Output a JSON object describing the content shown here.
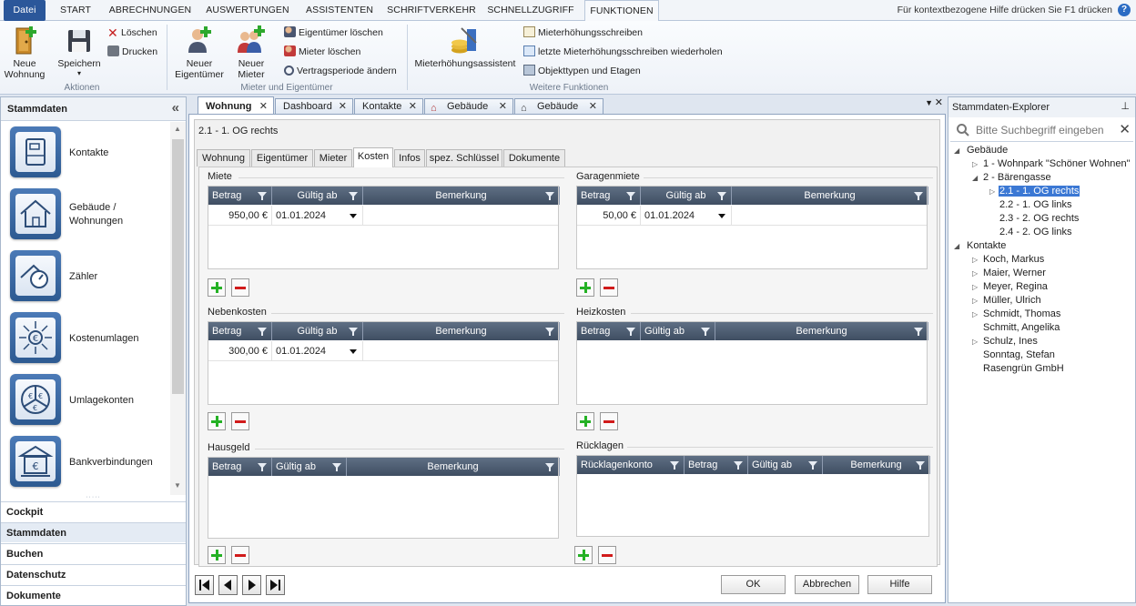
{
  "menu": {
    "tabs": [
      "Datei",
      "START",
      "ABRECHNUNGEN",
      "AUSWERTUNGEN",
      "ASSISTENTEN",
      "SCHRIFTVERKEHR",
      "SCHNELLZUGRIFF",
      "FUNKTIONEN"
    ],
    "help_text": "Für kontextbezogene Hilfe drücken Sie F1 drücken",
    "help_icon": "?"
  },
  "ribbon": {
    "neue_wohnung": "Neue Wohnung",
    "speichern": "Speichern",
    "loeschen": "Löschen",
    "drucken": "Drucken",
    "group_aktionen": "Aktionen",
    "neuer_eigentuemer": "Neuer Eigentümer",
    "neuer_mieter": "Neuer Mieter",
    "eigentuemer_loeschen": "Eigentümer löschen",
    "mieter_loeschen": "Mieter löschen",
    "vertragsperiode": "Vertragsperiode ändern",
    "group_mieter": "Mieter und Eigentümer",
    "assistent": "Mieterhöhungsassistent",
    "schreiben": "Mieterhöhungsschreiben",
    "letzte_schreiben": "letzte Mieterhöhungsschreiben wiederholen",
    "objekttypen": "Objekttypen und Etagen",
    "group_weitere": "Weitere Funktionen"
  },
  "left": {
    "header": "Stammdaten",
    "collapse": "«",
    "items": [
      {
        "label": "Kontakte",
        "icon": "contacts-icon"
      },
      {
        "label": "Gebäude / Wohnungen",
        "icon": "house-icon"
      },
      {
        "label": "Zähler",
        "icon": "meter-icon"
      },
      {
        "label": "Kostenumlagen",
        "icon": "euro-distribution-icon"
      },
      {
        "label": "Umlagekonten",
        "icon": "euro-pie-icon"
      },
      {
        "label": "Bankverbindungen",
        "icon": "bank-icon"
      }
    ],
    "sections": [
      "Cockpit",
      "Stammdaten",
      "Buchen",
      "Datenschutz",
      "Dokumente"
    ]
  },
  "doc_tabs": [
    "Wohnung",
    "Dashboard",
    "Kontakte",
    "Gebäude",
    "Gebäude"
  ],
  "object_title": "2.1 - 1. OG rechts",
  "page_tabs": [
    "Wohnung",
    "Eigentümer",
    "Mieter",
    "Kosten",
    "Infos",
    "spez. Schlüssel",
    "Dokumente"
  ],
  "sections": {
    "miete": {
      "title": "Miete",
      "cols": [
        "Betrag",
        "Gültig ab",
        "Bemerkung"
      ],
      "row": {
        "betrag": "950,00 €",
        "datum": "01.01.2024"
      }
    },
    "garagenmiete": {
      "title": "Garagenmiete",
      "cols": [
        "Betrag",
        "Gültig ab",
        "Bemerkung"
      ],
      "row": {
        "betrag": "50,00 €",
        "datum": "01.01.2024"
      }
    },
    "nebenkosten": {
      "title": "Nebenkosten",
      "cols": [
        "Betrag",
        "Gültig ab",
        "Bemerkung"
      ],
      "row": {
        "betrag": "300,00 €",
        "datum": "01.01.2024"
      }
    },
    "heizkosten": {
      "title": "Heizkosten",
      "cols": [
        "Betrag",
        "Gültig ab",
        "Bemerkung"
      ]
    },
    "hausgeld": {
      "title": "Hausgeld",
      "cols": [
        "Betrag",
        "Gültig ab",
        "Bemerkung"
      ]
    },
    "ruecklagen": {
      "title": "Rücklagen",
      "cols": [
        "Rücklagenkonto",
        "Betrag",
        "Gültig ab",
        "Bemerkung"
      ]
    }
  },
  "buttons": {
    "ok": "OK",
    "abbrechen": "Abbrechen",
    "hilfe": "Hilfe"
  },
  "explorer": {
    "title": "Stammdaten-Explorer",
    "pin": "⊥",
    "search_placeholder": "Bitte Suchbegriff eingeben",
    "tree": {
      "gebaeude": "Gebäude",
      "wohnpark": "1 - Wohnpark \"Schöner Wohnen\"",
      "baerengasse": "2 - Bärengasse",
      "og_rechts": "2.1 - 1. OG rechts",
      "og_links": "2.2 - 1. OG links",
      "og2_rechts": "2.3 - 2. OG rechts",
      "og2_links": "2.4 - 2. OG links",
      "kontakte": "Kontakte",
      "people": [
        "Koch, Markus",
        "Maier, Werner",
        "Meyer, Regina",
        "Müller, Ulrich",
        "Schmidt, Thomas",
        "Schmitt, Angelika",
        "Schulz, Ines",
        "Sonntag, Stefan",
        "Rasengrün GmbH"
      ]
    }
  }
}
